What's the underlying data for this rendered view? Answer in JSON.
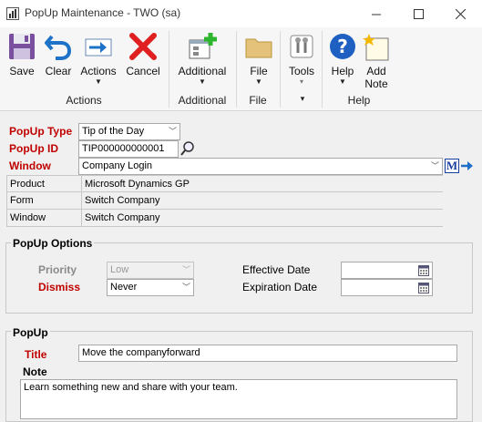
{
  "window": {
    "title": "PopUp Maintenance  -  TWO (sa)"
  },
  "ribbon": {
    "buttons": {
      "save": "Save",
      "clear": "Clear",
      "actions": "Actions",
      "cancel": "Cancel",
      "additional": "Additional",
      "file": "File",
      "tools": "Tools",
      "help": "Help",
      "add_note_line1": "Add",
      "add_note_line2": "Note"
    },
    "groups": {
      "actions": "Actions",
      "additional": "Additional",
      "file": "File",
      "help": "Help"
    }
  },
  "form": {
    "popup_type_label": "PopUp Type",
    "popup_type_value": "Tip of the Day",
    "popup_id_label": "PopUp ID",
    "popup_id_value": "TIP000000000001",
    "window_label": "Window",
    "window_value": "Company Login",
    "product_label": "Product",
    "product_value": "Microsoft Dynamics GP",
    "form_label": "Form",
    "form_value": "Switch Company",
    "window2_label": "Window",
    "window2_value": "Switch Company"
  },
  "options": {
    "section_title": "PopUp Options",
    "priority_label": "Priority",
    "priority_value": "Low",
    "dismiss_label": "Dismiss",
    "dismiss_value": "Never",
    "effective_date_label": "Effective Date",
    "effective_date_value": "",
    "expiration_date_label": "Expiration Date",
    "expiration_date_value": ""
  },
  "popup": {
    "section_title": "PopUp",
    "title_label": "Title",
    "title_value": "Move the companyforward",
    "note_label": "Note",
    "note_value": "Learn something new and share with your team."
  },
  "colors": {
    "required_label": "#c00000",
    "lookup_m": "#1b3f9e",
    "arrow": "#1f6fc6"
  }
}
